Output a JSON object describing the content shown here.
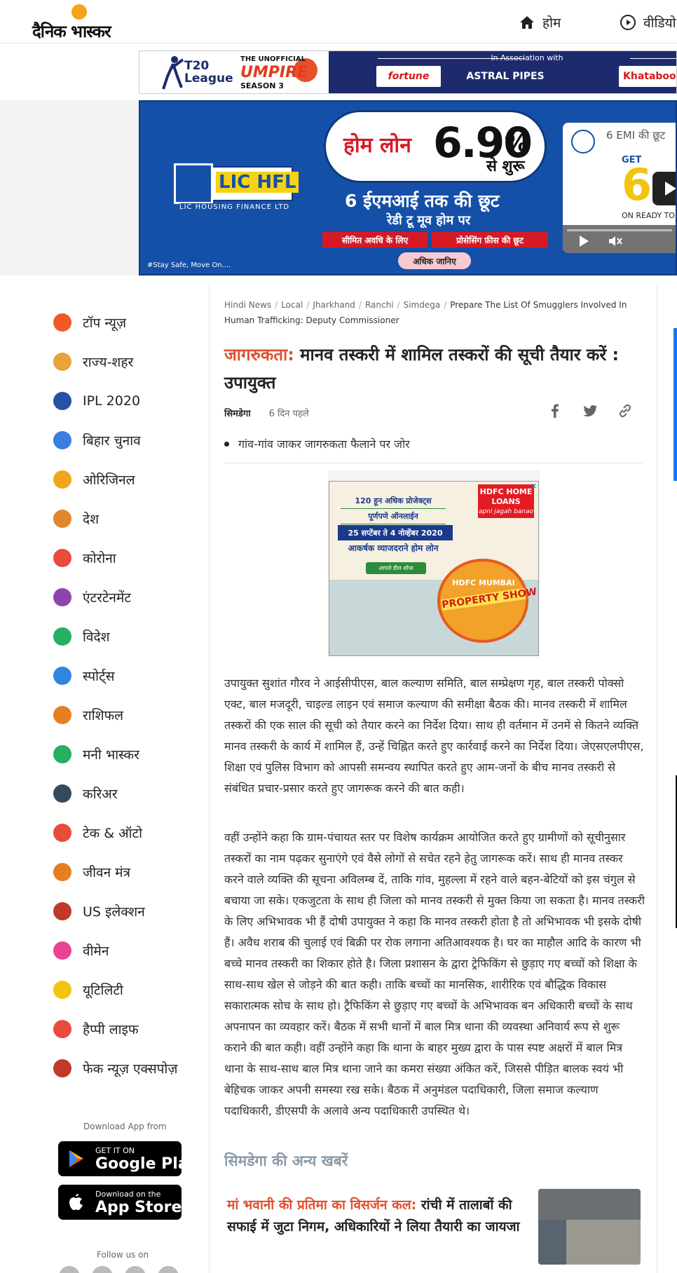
{
  "header": {
    "logo_text": "दैनिक भास्कर",
    "nav": [
      {
        "label": "होम",
        "icon": "home-icon"
      },
      {
        "label": "वीडियो",
        "icon": "play-circle-icon"
      }
    ]
  },
  "promo_strip": {
    "t20_label": "T20\nLeague",
    "unofficial": "THE UNOFFICIAL",
    "umpire": "UMPIRE",
    "season": "SEASON 3",
    "association": "In Association with",
    "sponsors": [
      "fortune",
      "ASTRAL PIPES",
      "Khataboo"
    ]
  },
  "lic_ad": {
    "brand": "LIC HFL",
    "brand_sub": "LIC HOUSING FINANCE LTD",
    "loan_label": "होम लोन",
    "rate": "6.90",
    "rate_pct": "%",
    "from": "से शुरू",
    "emi_line": "6 ईएमआई तक की छूट",
    "ready_line": "रेडी टू मूव होम पर",
    "tag_a": "सीमित अवधि के लिए",
    "tag_b": "प्रोसेसिंग फ़ीस की छूट",
    "more": "अधिक जानिए",
    "tagline": "#Stay Safe, Move On....",
    "video_title": "6 EMI की छूट",
    "video_get": "GET",
    "video_big": "6",
    "video_ready": "ON READY TO"
  },
  "sidebar": {
    "items": [
      {
        "label": "टॉप न्यूज़",
        "icon": "fire-icon",
        "color": "#f05a28"
      },
      {
        "label": "राज्य-शहर",
        "icon": "city-icon",
        "color": "#e8a33b"
      },
      {
        "label": "IPL 2020",
        "icon": "cricket-icon",
        "color": "#2a4fa6"
      },
      {
        "label": "बिहार चुनाव",
        "icon": "vote-icon",
        "color": "#3b7de0"
      },
      {
        "label": "ओरिजिनल",
        "icon": "lamp-icon",
        "color": "#f2a51a"
      },
      {
        "label": "देश",
        "icon": "india-gate-icon",
        "color": "#e0862b"
      },
      {
        "label": "कोरोना",
        "icon": "virus-icon",
        "color": "#e74c3c"
      },
      {
        "label": "एंटरटेनमेंट",
        "icon": "clapper-icon",
        "color": "#8e44ad"
      },
      {
        "label": "विदेश",
        "icon": "globe-icon",
        "color": "#27ae60"
      },
      {
        "label": "स्पोर्ट्स",
        "icon": "runner-icon",
        "color": "#2e86de"
      },
      {
        "label": "राशिफल",
        "icon": "zodiac-icon",
        "color": "#e67e22"
      },
      {
        "label": "मनी भास्कर",
        "icon": "rupee-icon",
        "color": "#27ae60"
      },
      {
        "label": "करिअर",
        "icon": "graduation-cap-icon",
        "color": "#34495e"
      },
      {
        "label": "टेक & ऑटो",
        "icon": "car-icon",
        "color": "#e74c3c"
      },
      {
        "label": "जीवन मंत्र",
        "icon": "book-icon",
        "color": "#e67e22"
      },
      {
        "label": "US इलेक्शन",
        "icon": "us-flag-icon",
        "color": "#c0392b"
      },
      {
        "label": "वीमेन",
        "icon": "women-icon",
        "color": "#e84393"
      },
      {
        "label": "यूटिलिटी",
        "icon": "bulb-icon",
        "color": "#f1c40f"
      },
      {
        "label": "हैप्पी लाइफ",
        "icon": "heart-icon",
        "color": "#e74c3c"
      },
      {
        "label": "फेक न्यूज़ एक्सपोज़",
        "icon": "fake-news-icon",
        "color": "#c0392b"
      }
    ],
    "download_label": "Download App from",
    "google_play": {
      "small": "GET IT ON",
      "big": "Google Play"
    },
    "app_store": {
      "small": "Download on the",
      "big": "App Store"
    },
    "follow_label": "Follow us on"
  },
  "article": {
    "breadcrumb": [
      "Hindi News",
      "Local",
      "Jharkhand",
      "Ranchi",
      "Simdega"
    ],
    "breadcrumb_current": "Prepare The List Of Smugglers Involved In Human Trafficking: Deputy Commissioner",
    "kicker": "जागरुकता:",
    "title": " मानव तस्करी में शामिल तस्करों की सूची तैयार करें : उपायुक्त",
    "place": "सिमडेगा",
    "time": "6 दिन पहले",
    "bullet": "गांव-गांव जाकर जागरुकता फैलाने पर जोर",
    "paragraphs": [
      "उपायुक्त सुशांत गौरव ने आईसीपीएस, बाल कल्याण समिति, बाल सम्प्रेक्षण गृह, बाल तस्करी पोक्सो एक्ट, बाल मजदूरी, चाइल्ड लाइन एवं समाज कल्याण की समीक्षा बैठक की। मानव तस्करी में शामिल तस्करों की एक साल की सूची को तैयार करने का निर्देश दिया। साथ ही वर्तमान में उनमें से कितने व्यक्ति मानव तस्करी के कार्य में शामिल हैं, उन्हें चिह्नित करते हुए कार्रवाई करने का निर्देश दिया। जेएसएलपीएस, शिक्षा एवं पुलिस विभाग को आपसी समन्वय स्थापित करते हुए आम-जनों के बीच मानव तस्करी से संबंधित प्रचार-प्रसार करते हुए जागरूक करने की बात कही।",
      "वहीं उन्होंने कहा कि ग्राम-पंचायत स्तर पर विशेष कार्यक्रम आयोजित करते हुए ग्रामीणों को सूचीनुसार तस्करों का नाम पढ़कर सुनाएंगे एवं वैसे लोगों से सचेत रहने हेतु जागरूक करें। साथ ही मानव तस्कर करने वाले व्यक्ति की सूचना अविलम्ब दें, ताकि गांव, मुहल्ला में रहने वाले बहन-बेटियों को इस चंगुल से बचाया जा सके। एकजुटता के साथ ही जिला को मानव तस्करी से मुक्त किया जा सकता है। मानव तस्करी के लिए अभिभावक भी हैं दोषी उपायुक्त ने कहा कि मानव तस्करी होता है तो अभिभावक भी इसके दोषी हैं। अवैध शराब की चुलाई एवं बिक्री पर रोक लगाना अतिआवश्यक है। घर का माहौल आदि के कारण भी बच्चे मानव तस्करी का शिकार होते है। जिला प्रशासन के द्वारा ट्रेफिकिंग से छुड़ाए गए बच्चों को शिक्षा के साथ-साथ खेल से जोड़ने की बात कही। ताकि बच्चों का मानसिक, शारीरिक एवं बौद्धिक विकास सकारात्मक सोच के साथ हो। ट्रैफिकिंग से छुड़ाए गए बच्चों के अभिभावक बन अधिकारी बच्चों के साथ अपनापन का व्यवहार करें। बैठक में सभी थानों में बाल मित्र थाना की व्यवस्था अनिवार्य रूप से शुरू कराने की बात कही। वहीं उन्होंने कहा कि थाना के बाहर मुख्य द्वारा के पास स्पष्ट अक्षरों में बाल मित्र थाना के साथ-साथ बाल मित्र थाना जाने का कमरा संख्या अंकित करें, जिससे पीड़ित बालक स्वयं भी बेहिचक जाकर अपनी समस्या रख सके। बैठक में अनुमंडल पदाधिकारी, जिला समाज कल्याण पदाधिकारी, डीएसपी के अलावे अन्य पदाधिकारी उपस्थित थे।"
    ],
    "more_heading": "सिमडेगा की अन्य खबरें",
    "story": {
      "kicker": "मां भवानी की प्रतिमा का विसर्जन कल:",
      "headline": " रांची में तालाबों की सफाई में जुटा निगम, अधिकारियों ने लिया तैयारी का जायजा"
    }
  },
  "hdfc_ad": {
    "line1": "120 हून अधिक प्रोजेक्ट्स",
    "line2": "पूर्णपणे ऑनलाईन",
    "dates": "25 सप्टेंबर ते 4 नोव्हेंबर 2020",
    "line3": "आकर्षक व्याजदराने होम लोन",
    "btn": "आपले डील शोधा",
    "logo": "HDFC HOME LOANS",
    "logo_tag": "apni jagah banao",
    "badge_top": "HDFC MUMBAI",
    "badge": "PROPERTY SHOW"
  }
}
